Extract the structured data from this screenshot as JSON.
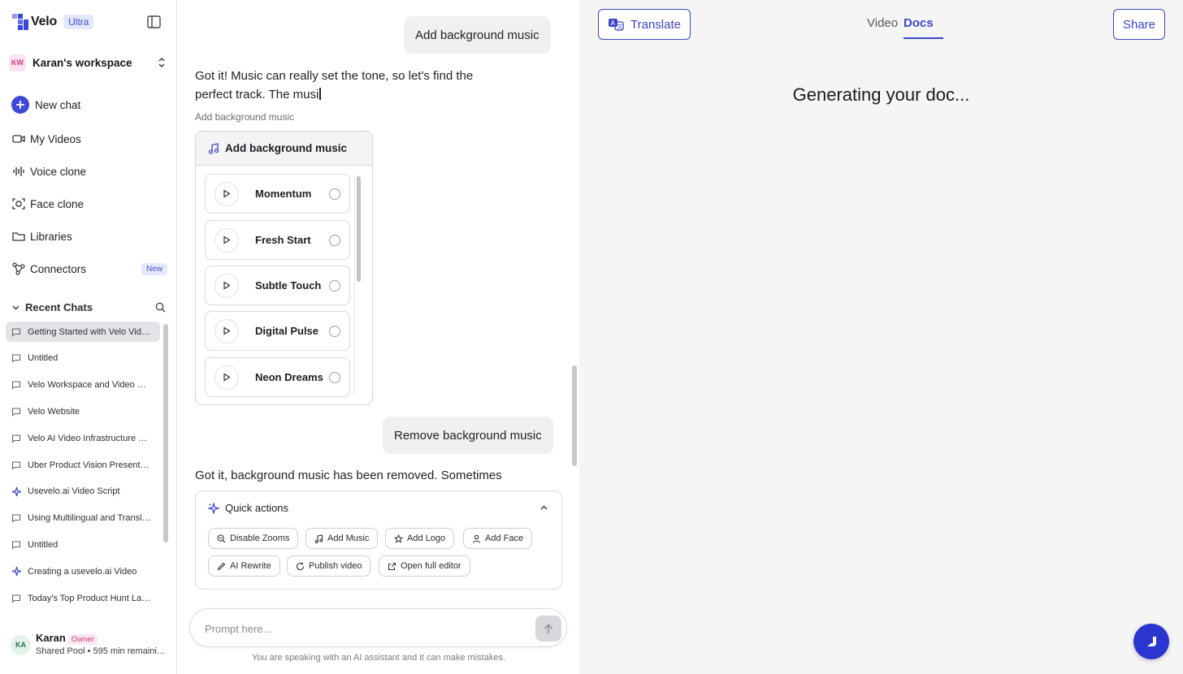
{
  "sidebar": {
    "brand": "Velo",
    "plan_badge": "Ultra",
    "workspace": {
      "initials": "KW",
      "name": "Karan's workspace"
    },
    "nav": {
      "new_chat": "New chat",
      "my_videos": "My Videos",
      "voice_clone": "Voice clone",
      "face_clone": "Face clone",
      "libraries": "Libraries",
      "connectors": "Connectors",
      "connectors_badge": "New"
    },
    "recent_header": "Recent Chats",
    "recent_chats": [
      {
        "title": "Getting Started with Velo Vid…",
        "icon": "chat-bubble-icon",
        "active": true
      },
      {
        "title": "Untitled",
        "icon": "chat-bubble-icon"
      },
      {
        "title": "Velo Workspace and Video Sc…",
        "icon": "chat-bubble-icon"
      },
      {
        "title": "Velo Website",
        "icon": "chat-bubble-icon"
      },
      {
        "title": "Velo AI Video Infrastructure O…",
        "icon": "chat-bubble-icon"
      },
      {
        "title": "Uber Product Vision Presenta…",
        "icon": "chat-bubble-icon"
      },
      {
        "title": "Usevelo.ai Video Script",
        "icon": "sparkle-icon"
      },
      {
        "title": "Using Multilingual and Transla…",
        "icon": "chat-bubble-icon"
      },
      {
        "title": "Untitled",
        "icon": "chat-bubble-icon"
      },
      {
        "title": "Creating a usevelo.ai Video",
        "icon": "sparkle-icon"
      },
      {
        "title": "Today's Top Product Hunt La…",
        "icon": "chat-bubble-icon"
      }
    ],
    "user": {
      "initials": "KA",
      "name": "Karan",
      "role": "Owner",
      "pool": "Shared Pool • 595 min remaini…"
    }
  },
  "chat": {
    "user_message_1": "Add background music",
    "assistant_text_1_line1": "Got it! Music can really set the tone, so let's find the",
    "assistant_text_1_line2": "perfect track. The musi",
    "tool_label": "Add background music",
    "music_card": {
      "title": "Add background music",
      "tracks": [
        "Momentum",
        "Fresh Start",
        "Subtle Touch",
        "Digital Pulse",
        "Neon Dreams"
      ]
    },
    "user_message_2": "Remove background music",
    "assistant_text_2": "Got it, background music has been removed. Sometimes",
    "quick_actions": {
      "title": "Quick actions",
      "buttons": [
        {
          "label": "Disable Zooms",
          "icon": "zoom-out-icon"
        },
        {
          "label": "Add Music",
          "icon": "music-note-icon"
        },
        {
          "label": "Add Logo",
          "icon": "star-icon"
        },
        {
          "label": "Add Face",
          "icon": "person-icon"
        },
        {
          "label": "AI Rewrite",
          "icon": "pencil-icon"
        },
        {
          "label": "Publish video",
          "icon": "refresh-icon"
        },
        {
          "label": "Open full editor",
          "icon": "external-link-icon"
        }
      ]
    },
    "prompt_placeholder": "Prompt here...",
    "disclaimer": "You are speaking with an AI assistant and it can make mistakes."
  },
  "panel": {
    "translate_label": "Translate",
    "tabs": {
      "video": "Video",
      "docs": "Docs",
      "active": "docs"
    },
    "share_label": "Share",
    "status_text": "Generating your doc..."
  },
  "colors": {
    "accent": "#3b46c8",
    "brand_blue": "#3e49d8",
    "panel_bg": "#f5f5f5"
  }
}
